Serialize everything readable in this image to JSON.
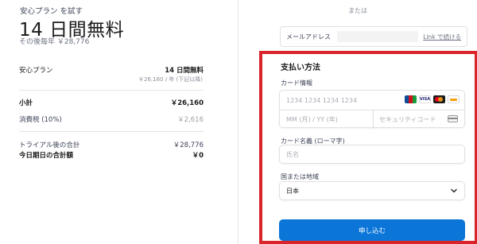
{
  "summary": {
    "plan_trial_label": "安心プラン を試す",
    "headline": "14 日間無料",
    "after_price": "その後毎年 ￥28,776",
    "plan_name": "安心プラン",
    "plan_amount": "14 日間無料",
    "plan_subtext": "￥26,160 / 年 (下記以降)",
    "subtotal_label": "小計",
    "subtotal_value": "￥26,160",
    "tax_label": "消費税 (10%)",
    "tax_value": "￥2,616",
    "after_trial_label": "トライアル後の合計",
    "after_trial_value": "￥28,776",
    "today_label": "今日期日の合計額",
    "today_value": "￥0"
  },
  "checkout": {
    "or_text": "または",
    "email_label": "メールアドレス",
    "email_value": "",
    "link_label": "Link で続ける",
    "payment_title": "支払い方法",
    "card_info_label": "カード情報",
    "card_number_placeholder": "1234 1234 1234 1234",
    "card_brands": [
      "JCB",
      "VISA",
      "Mastercard",
      "Discover"
    ],
    "expiry_placeholder": "MM (月) / YY (年)",
    "cvc_placeholder": "セキュリティコード",
    "cardholder_label": "カード名義 (ローマ字)",
    "cardholder_placeholder": "氏名",
    "country_label": "国または地域",
    "country_value": "日本",
    "submit_label": "申し込む"
  },
  "colors": {
    "accent_button": "#0b75d8",
    "highlight_border": "#d9252a"
  }
}
